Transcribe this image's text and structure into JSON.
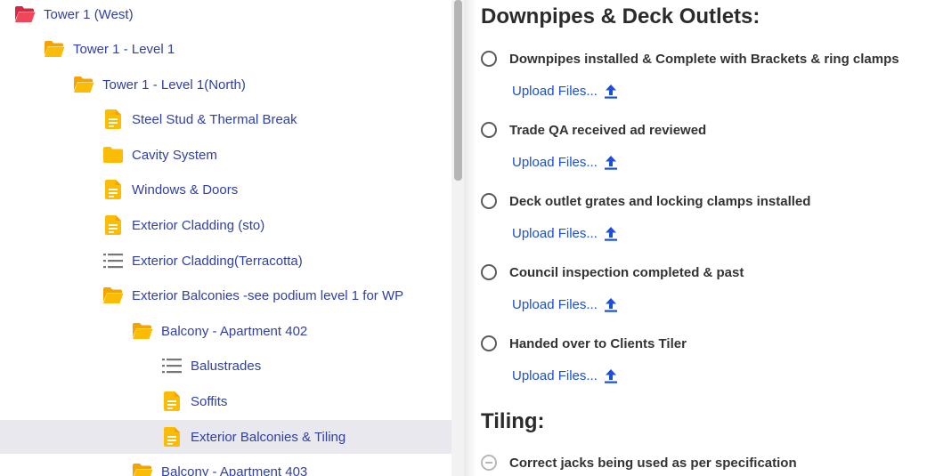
{
  "tree": {
    "items": [
      {
        "label": "Tower 1 (West)",
        "icon": "folder-open-icon-red",
        "depth": 0
      },
      {
        "label": "Tower 1 - Level 1",
        "icon": "folder-open-icon",
        "depth": 1
      },
      {
        "label": "Tower 1 - Level 1(North)",
        "icon": "folder-open-icon",
        "depth": 2
      },
      {
        "label": "Steel Stud & Thermal Break",
        "icon": "document-icon",
        "depth": 3
      },
      {
        "label": "Cavity System",
        "icon": "folder-icon",
        "depth": 3
      },
      {
        "label": "Windows & Doors",
        "icon": "document-icon",
        "depth": 3
      },
      {
        "label": "Exterior Cladding (sto)",
        "icon": "document-icon",
        "depth": 3
      },
      {
        "label": "Exterior Cladding(Terracotta)",
        "icon": "list-icon",
        "depth": 3
      },
      {
        "label": "Exterior Balconies -see podium level 1 for WP",
        "icon": "folder-open-icon",
        "depth": 3
      },
      {
        "label": "Balcony - Apartment 402",
        "icon": "folder-open-icon",
        "depth": 4
      },
      {
        "label": "Balustrades",
        "icon": "list-icon",
        "depth": 5
      },
      {
        "label": "Soffits",
        "icon": "document-icon",
        "depth": 5
      },
      {
        "label": "Exterior Balconies & Tiling",
        "icon": "document-icon",
        "depth": 5,
        "selected": true
      },
      {
        "label": "Balcony - Apartment 403",
        "icon": "folder-open-icon",
        "depth": 4
      }
    ]
  },
  "main": {
    "sections": [
      {
        "title": "Downpipes & Deck Outlets:",
        "items": [
          {
            "label": "Downpipes installed & Complete with Brackets & ring clamps",
            "upload": "Upload Files..."
          },
          {
            "label": "Trade QA received ad reviewed",
            "upload": "Upload Files..."
          },
          {
            "label": "Deck outlet grates and locking clamps installed",
            "upload": "Upload Files..."
          },
          {
            "label": "Council inspection completed & past",
            "upload": "Upload Files..."
          },
          {
            "label": "Handed over to Clients Tiler",
            "upload": "Upload Files..."
          }
        ]
      },
      {
        "title": "Tiling:",
        "items": [
          {
            "label": "Correct jacks being used as per specification",
            "disabled": true
          }
        ]
      }
    ]
  },
  "colors": {
    "link": "#2f3fa8",
    "upload_link": "#1a4fd6",
    "folder_yellow": "#fbbc05",
    "folder_red": "#f0465a",
    "selected_row": "#e8e8ee"
  }
}
